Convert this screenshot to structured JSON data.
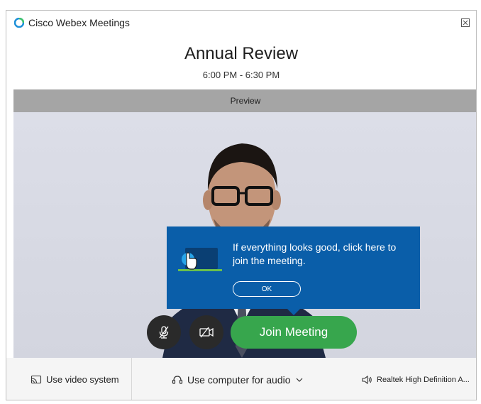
{
  "window": {
    "app_title": "Cisco Webex Meetings",
    "logo_icon": "webex-logo-icon",
    "close_icon": "close-icon"
  },
  "meeting": {
    "title": "Annual Review",
    "time": "6:00 PM - 6:30 PM"
  },
  "preview": {
    "label": "Preview"
  },
  "tooltip": {
    "text": "If everything looks good, click here to join the meeting.",
    "ok_label": "OK"
  },
  "controls": {
    "mute_icon": "microphone-muted-icon",
    "video_icon": "camera-off-icon",
    "join_label": "Join Meeting"
  },
  "bottom_bar": {
    "video_system_label": "Use video system",
    "audio_label": "Use computer for audio",
    "speaker_label": "Realtek High Definition A..."
  },
  "colors": {
    "join_green": "#37a64d",
    "tooltip_blue": "#0a5ea9",
    "preview_bar": "#a5a5a5"
  }
}
